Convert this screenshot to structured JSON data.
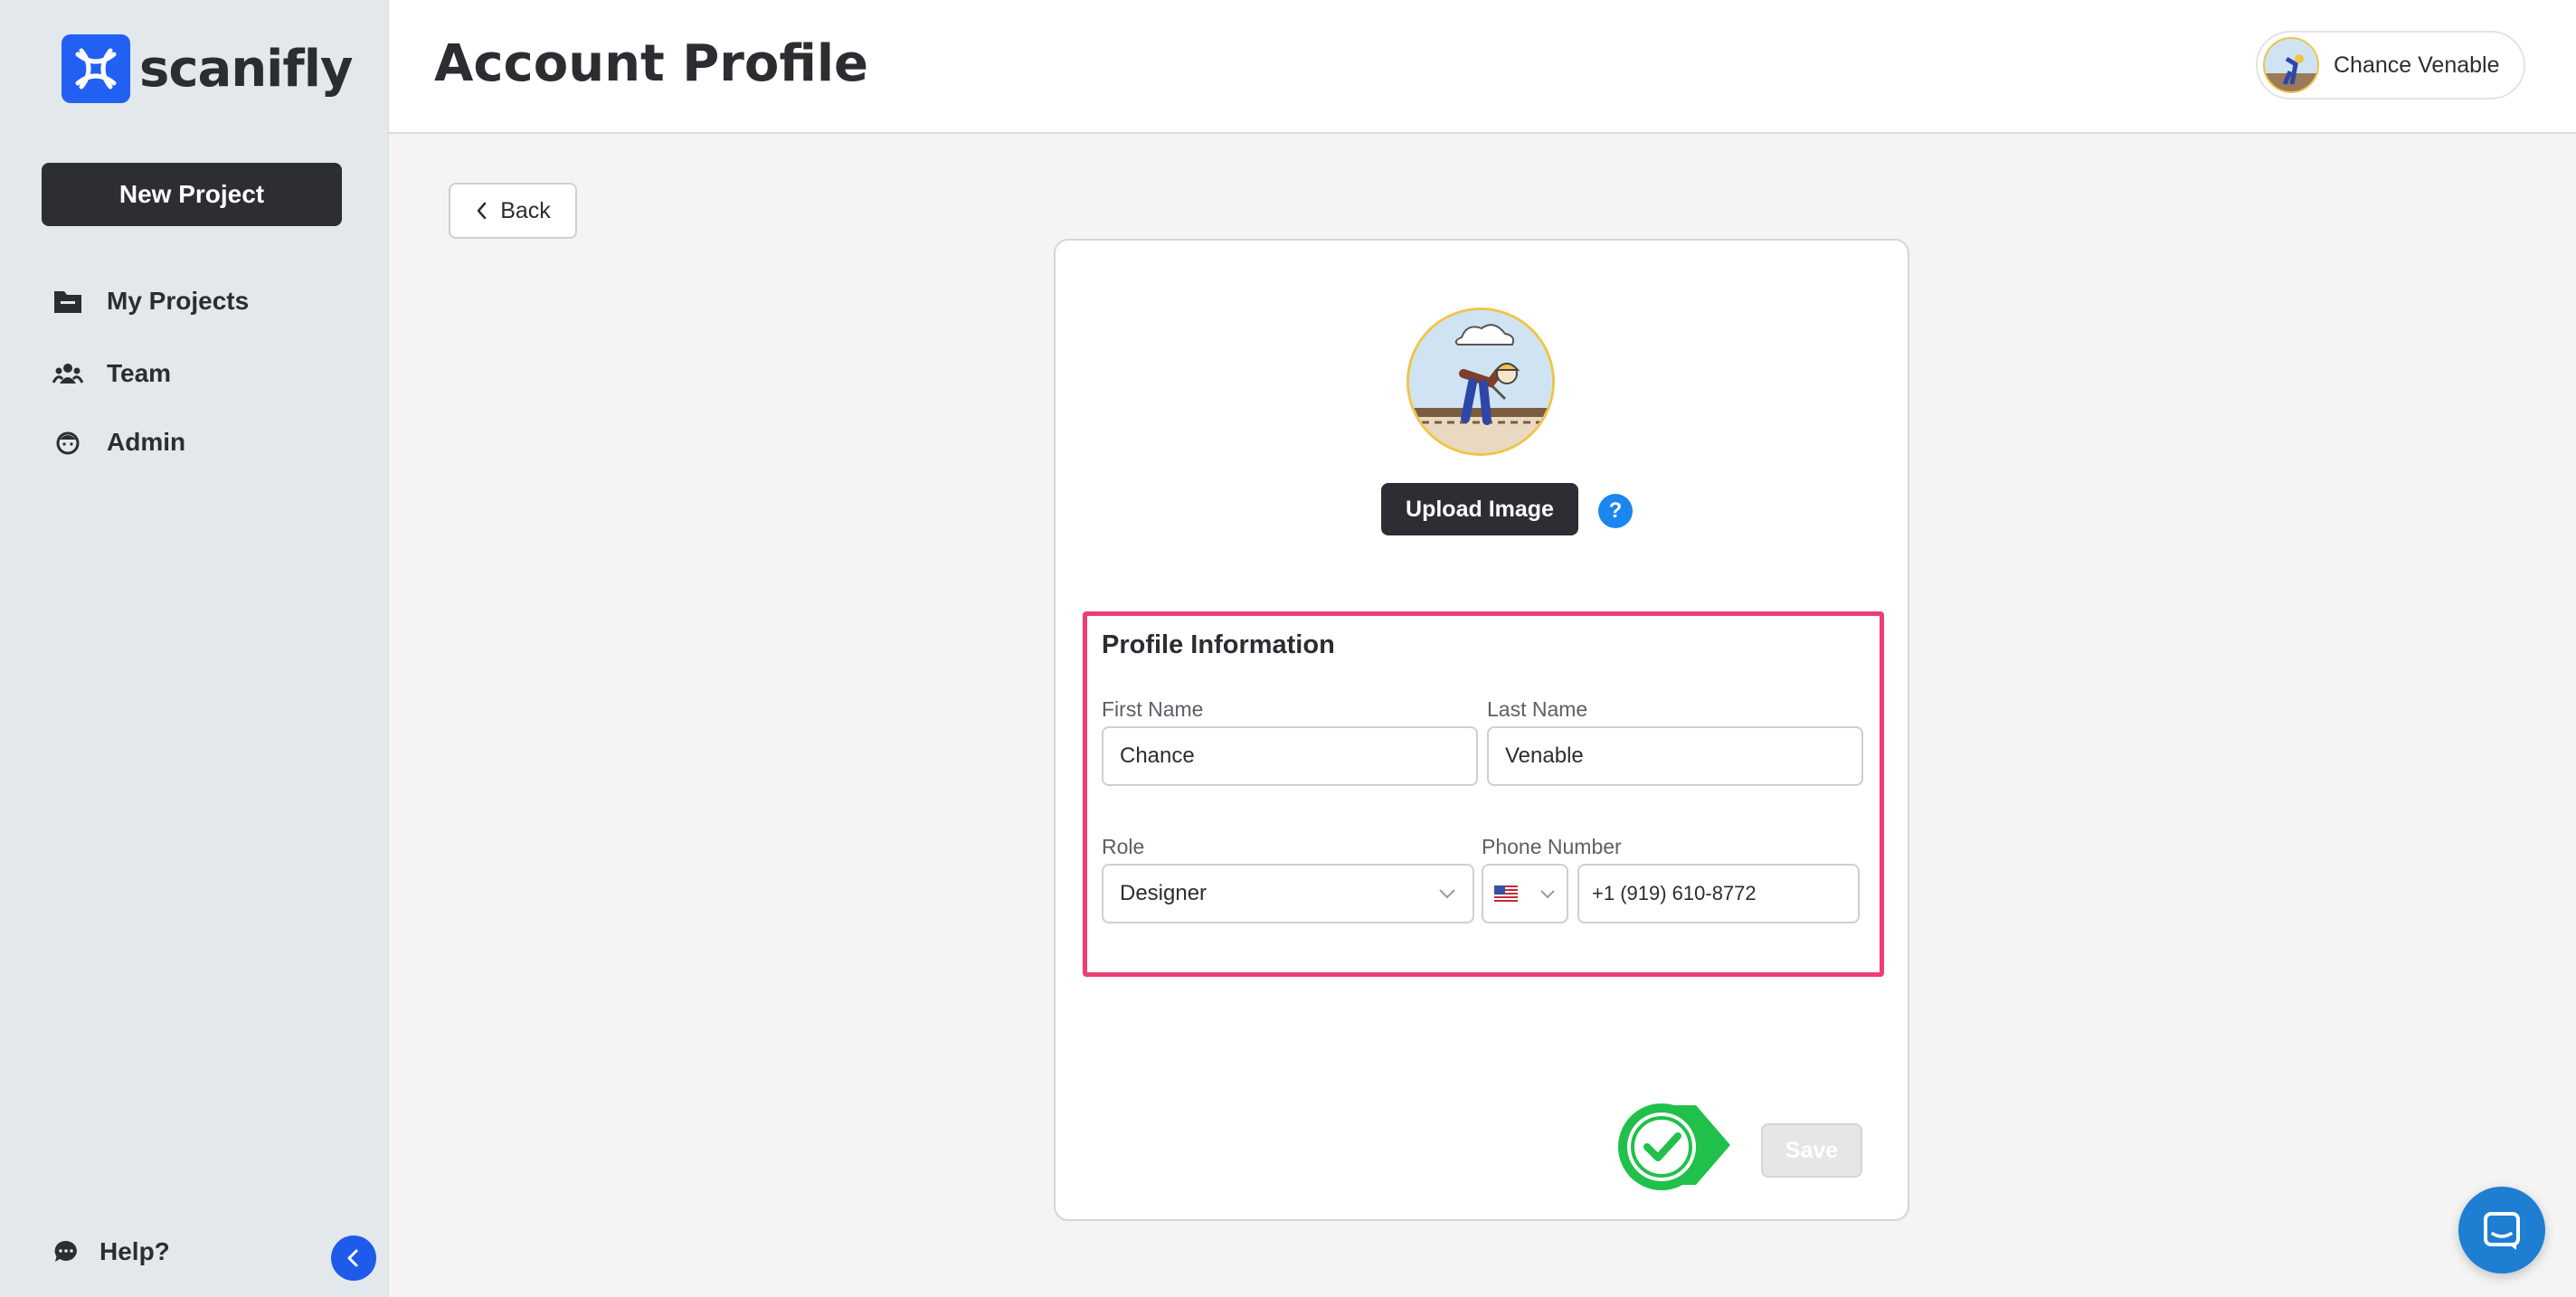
{
  "brand": {
    "name": "scanifly",
    "color": "#2160f3"
  },
  "sidebar": {
    "new_project_label": "New Project",
    "items": [
      {
        "label": "My Projects",
        "icon": "folder-icon"
      },
      {
        "label": "Team",
        "icon": "team-icon"
      },
      {
        "label": "Admin",
        "icon": "admin-icon"
      }
    ],
    "help_label": "Help?",
    "collapse_icon": "chevron-left-icon"
  },
  "header": {
    "title": "Account Profile",
    "user_name": "Chance Venable"
  },
  "back_label": "Back",
  "profile": {
    "upload_label": "Upload Image",
    "help_glyph": "?",
    "section_title": "Profile Information",
    "first_name": {
      "label": "First Name",
      "value": "Chance"
    },
    "last_name": {
      "label": "Last Name",
      "value": "Venable"
    },
    "role": {
      "label": "Role",
      "value": "Designer"
    },
    "phone": {
      "label": "Phone Number",
      "country_icon": "us-flag-icon",
      "value": "+1 (919) 610-8772"
    },
    "save_label": "Save"
  },
  "colors": {
    "highlight_border": "#ee3d73",
    "primary_dark": "#2c2e33",
    "accent_blue": "#1f5bea",
    "success_green": "#21c04a"
  }
}
